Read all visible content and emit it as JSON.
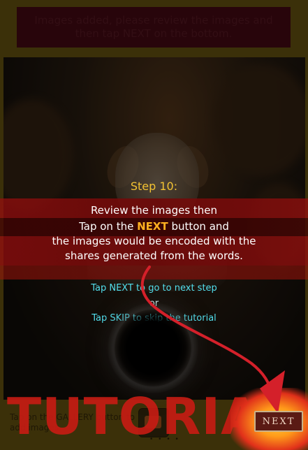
{
  "notice": {
    "text": "Images added, please review the images and then tap NEXT on the bottom."
  },
  "bottom": {
    "gallery_hint": "Tap on the GALLERY button to add images.",
    "dots": "• • • •"
  },
  "tutorial": {
    "step_title": "Step 10:",
    "line1": "Review the images then",
    "line2_pre": "Tap on the ",
    "line2_highlight": "NEXT",
    "line2_post": " button and",
    "line3": "the images would be encoded with the",
    "line4": "shares generated from the words.",
    "tip_next": "Tap NEXT to go to next step",
    "tip_or": "or",
    "tip_skip": "Tap SKIP to skip the tutorial",
    "watermark": "TUTORIAL"
  },
  "next_button": {
    "label": "NEXT"
  },
  "colors": {
    "title": "#f2c232",
    "highlight": "#ffb020",
    "tip": "#53e0ee",
    "band": "#8a0c0c",
    "arrow": "#d4202a"
  }
}
